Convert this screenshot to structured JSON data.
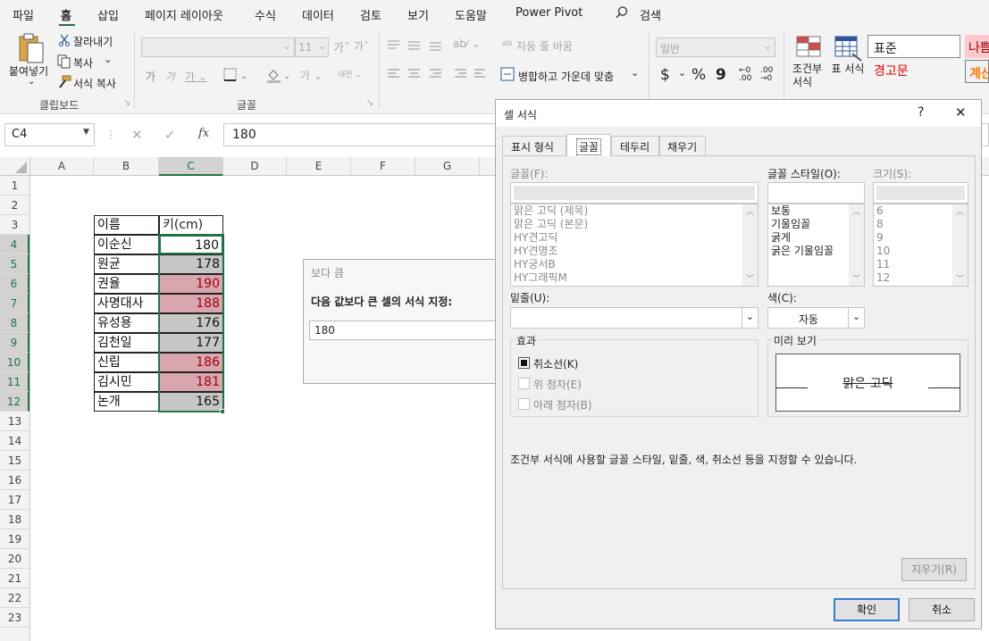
{
  "menu": {
    "items": [
      "파일",
      "홈",
      "삽입",
      "페이지 레이아웃",
      "수식",
      "데이터",
      "검토",
      "보기",
      "도움말",
      "Power Pivot"
    ],
    "search_label": "검색"
  },
  "ribbon": {
    "clipboard": {
      "paste_label": "붙여넣기",
      "cut_label": "잘라내기",
      "copy_label": "복사",
      "format_painter_label": "서식 복사",
      "group_label": "클립보드"
    },
    "font": {
      "font_size_value": "11",
      "group_label": "글꼴"
    },
    "alignment": {
      "wrap_text_label": "자동 줄 바꿈",
      "merge_center_label": "병합하고 가운데 맞춤"
    },
    "number": {
      "format_value": "일반",
      "currency_symbol": "$",
      "percent_symbol": "%",
      "comma_symbol": "9"
    },
    "styles": {
      "conditional_formatting_label": "조건부 서식",
      "format_as_table_label": "표 서식",
      "style_normal": "표준",
      "style_bad": "나쁨",
      "style_warning": "경고문",
      "style_calc": "계산"
    }
  },
  "formula_bar": {
    "name_box": "C4",
    "fx_label": "fx",
    "value": "180"
  },
  "grid": {
    "columns": [
      "A",
      "B",
      "C",
      "D",
      "E",
      "F",
      "G"
    ],
    "rows": [
      "1",
      "2",
      "3",
      "4",
      "5",
      "6",
      "7",
      "8",
      "9",
      "10",
      "11",
      "12",
      "13",
      "14",
      "15",
      "16",
      "17",
      "18",
      "19",
      "20",
      "21",
      "22",
      "23"
    ],
    "table_headers": [
      "이름",
      "키(cm)"
    ],
    "table_rows": [
      {
        "name": "이순신",
        "value": "180"
      },
      {
        "name": "원균",
        "value": "178"
      },
      {
        "name": "권율",
        "value": "190"
      },
      {
        "name": "사명대사",
        "value": "188"
      },
      {
        "name": "유성용",
        "value": "176"
      },
      {
        "name": "김천일",
        "value": "177"
      },
      {
        "name": "신립",
        "value": "186"
      },
      {
        "name": "김시민",
        "value": "181"
      },
      {
        "name": "논개",
        "value": "165"
      }
    ]
  },
  "greater_than_dialog": {
    "title": "보다 큼",
    "prompt": "다음 값보다 큰 셀의 서식 지정:",
    "input_value": "180"
  },
  "format_cells_dialog": {
    "title": "셀 서식",
    "help_symbol": "?",
    "close_symbol": "✕",
    "tabs": [
      "표시 형식",
      "글꼴",
      "테두리",
      "채우기"
    ],
    "active_tab": "글꼴",
    "font_label": "글꼴(F):",
    "font_list": [
      "맑은 고딕 (제목)",
      "맑은 고딕 (본문)",
      "HY견고딕",
      "HY견명조",
      "HY궁서B",
      "HY그래픽M"
    ],
    "font_style_label": "글꼴 스타일(O):",
    "font_style_list": [
      "보통",
      "기울임꼴",
      "굵게",
      "굵은 기울임꼴"
    ],
    "size_label": "크기(S):",
    "size_list": [
      "6",
      "8",
      "9",
      "10",
      "11",
      "12"
    ],
    "underline_label": "밑줄(U):",
    "color_label": "색(C):",
    "color_value": "자동",
    "effects_label": "효과",
    "strikethrough_label": "취소선(K)",
    "superscript_label": "위 첨자(E)",
    "subscript_label": "아래 첨자(B)",
    "preview_label": "미리 보기",
    "preview_text": "맑은 고딕",
    "description": "조건부 서식에 사용할 글꼴 스타일, 밑줄, 색, 취소선 등을 지정할 수 있습니다.",
    "clear_button": "지우기(R)",
    "ok_button": "확인",
    "cancel_button": "취소"
  }
}
